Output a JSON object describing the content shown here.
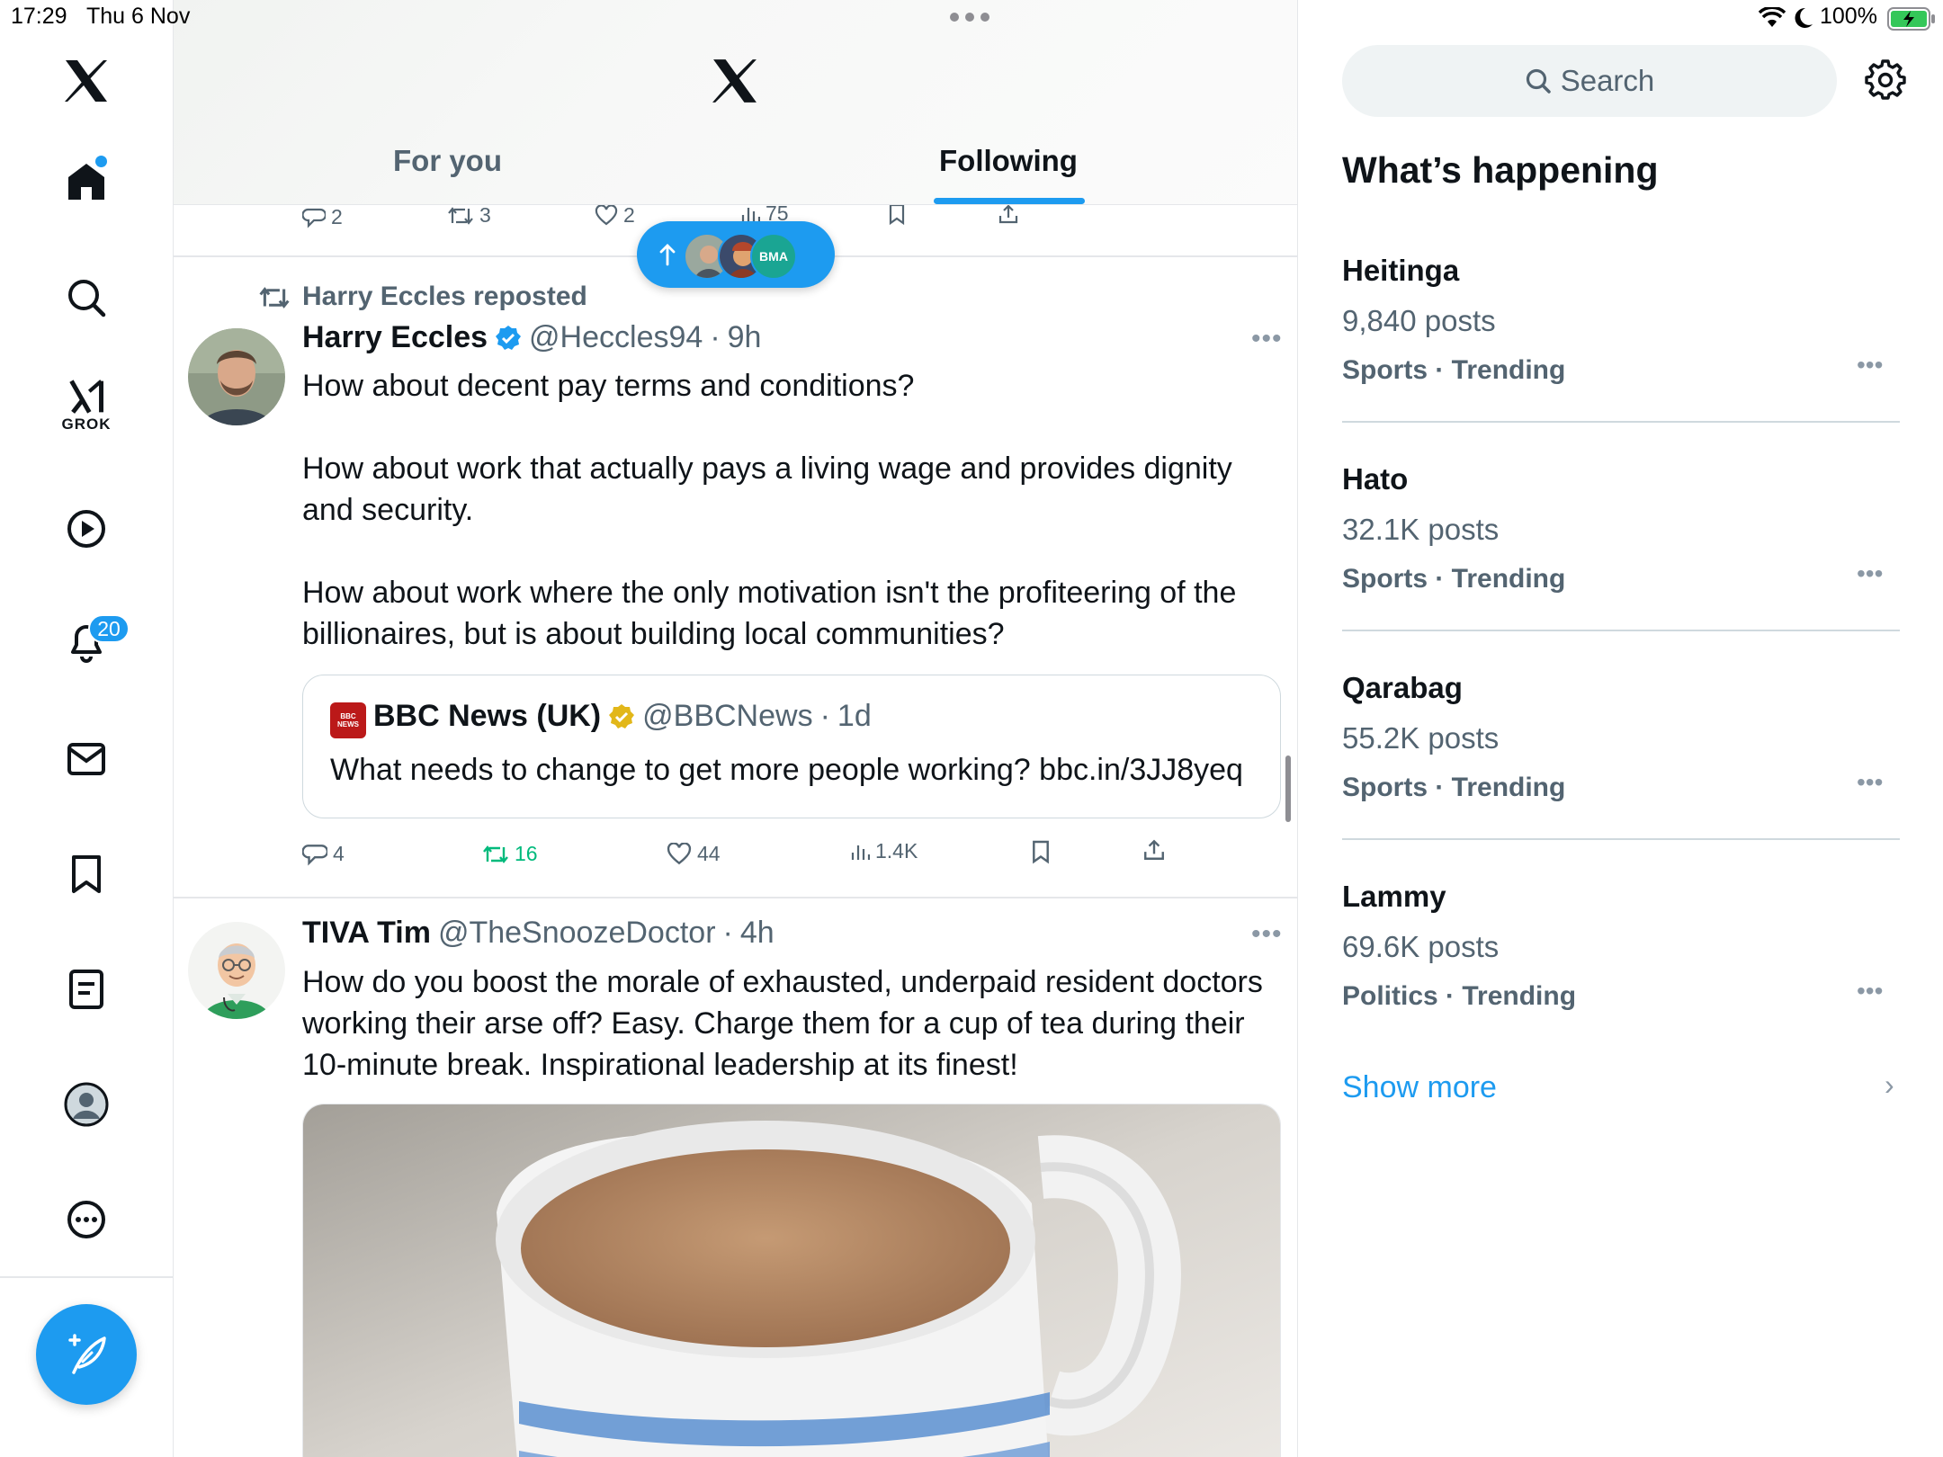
{
  "status_bar": {
    "time": "17:29",
    "date": "Thu 6 Nov",
    "battery": "100%"
  },
  "nav": {
    "notification_count": "20",
    "grok_label": "GROK"
  },
  "header": {
    "tab_for_you": "For you",
    "tab_following": "Following"
  },
  "prev_post": {
    "replies": "2",
    "reposts": "3",
    "likes": "2",
    "views": "75"
  },
  "pill": {
    "third_avatar_text": "BMA"
  },
  "post1": {
    "repost_label": "Harry Eccles reposted",
    "name": "Harry Eccles",
    "handle": "@Heccles94",
    "time": "9h",
    "text": "How about decent pay terms and conditions?\n\nHow about work that actually pays a living wage and provides dignity\nand security.\n\nHow about work where the only motivation isn't the profiteering of the\nbillionaires, but is about building local communities?",
    "quote": {
      "logo_text": "BBC NEWS",
      "name": "BBC News (UK)",
      "handle": "@BBCNews",
      "time": "1d",
      "text": "What needs to change to get more people working? bbc.in/3JJ8yeq"
    },
    "replies": "4",
    "reposts": "16",
    "likes": "44",
    "views": "1.4K",
    "colors": {
      "reposted": "#00ba7c"
    }
  },
  "post2": {
    "name": "TIVA Tim",
    "handle": "@TheSnoozeDoctor",
    "time": "4h",
    "text": "How do you boost the morale of exhausted, underpaid resident doctors\nworking their arse off? Easy. Charge them for a cup of tea during their\n10-minute break. Inspirational leadership at its finest!"
  },
  "sidebar": {
    "search_placeholder": "Search",
    "title": "What’s happening",
    "trends": [
      {
        "name": "Heitinga",
        "count": "9,840 posts",
        "category": "Sports · Trending"
      },
      {
        "name": "Hato",
        "count": "32.1K posts",
        "category": "Sports · Trending"
      },
      {
        "name": "Qarabag",
        "count": "55.2K posts",
        "category": "Sports · Trending"
      },
      {
        "name": "Lammy",
        "count": "69.6K posts",
        "category": "Politics · Trending"
      }
    ],
    "show_more": "Show more"
  },
  "theme": {
    "accent": "#1d9bf0",
    "text": "#0f1419",
    "muted": "#536471",
    "verified_business": "#e2b719",
    "bbc_red": "#bb1919"
  }
}
